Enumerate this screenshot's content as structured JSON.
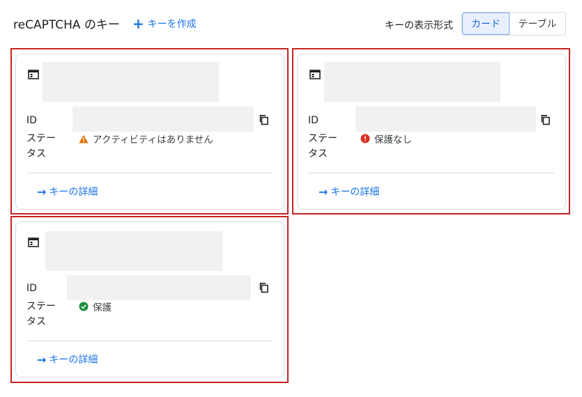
{
  "header": {
    "title": "reCAPTCHA のキー",
    "create_label": "キーを作成",
    "view_label": "キーの表示形式",
    "view_options": [
      "カード",
      "テーブル"
    ],
    "active_view": "カード"
  },
  "cards": [
    {
      "id_label": "ID",
      "status_label": "ステー\nタス",
      "status_text": "アクティビティはありません",
      "status_type": "warning",
      "details_label": "キーの詳細"
    },
    {
      "id_label": "ID",
      "status_label": "ステー\nタス",
      "status_text": "保護なし",
      "status_type": "error",
      "details_label": "キーの詳細"
    },
    {
      "id_label": "ID",
      "status_label": "ステー\nタス",
      "status_text": "保護",
      "status_type": "ok",
      "details_label": "キーの詳細"
    }
  ],
  "colors": {
    "accent": "#1a73e8",
    "highlight_outline": "#c5221f",
    "warning": "#e37400",
    "error": "#d93025",
    "ok": "#1e8e3e"
  }
}
